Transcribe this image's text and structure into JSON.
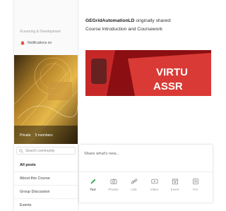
{
  "community": {
    "category": "#Learning & Development",
    "notifications_label": "Notifications on",
    "privacy": "Private",
    "members": "5 members",
    "search_placeholder": "Search community",
    "nav": [
      {
        "label": "All posts",
        "active": true
      },
      {
        "label": "About this Course",
        "active": false
      },
      {
        "label": "Group Discussion",
        "active": false
      },
      {
        "label": "Events",
        "active": false
      }
    ]
  },
  "post": {
    "author": "GEGridAutomationLD",
    "action": " originally shared:",
    "title": "Course Introduction and Coursework",
    "image_text_line1": "VIRTU",
    "image_text_line2": "ASSR"
  },
  "composer": {
    "placeholder": "Share what's new...",
    "tools": [
      {
        "label": "Text",
        "icon": "pencil-icon",
        "active": true
      },
      {
        "label": "Photos",
        "icon": "camera-icon",
        "active": false
      },
      {
        "label": "Link",
        "icon": "link-icon",
        "active": false
      },
      {
        "label": "Video",
        "icon": "video-icon",
        "active": false
      },
      {
        "label": "Event",
        "icon": "calendar-icon",
        "active": false
      },
      {
        "label": "Pol",
        "icon": "poll-icon",
        "active": false
      }
    ]
  },
  "colors": {
    "accent_green": "#3aa757",
    "bell_red": "#e0473a",
    "image_red": "#d32f2f"
  }
}
